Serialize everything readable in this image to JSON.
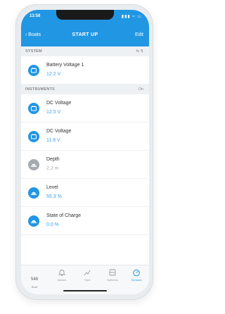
{
  "status_bar": {
    "time": "13:58",
    "icons": "▮▮▮ ≈ ▭"
  },
  "nav": {
    "back_label": "‹ Boats",
    "title": "START UP",
    "edit_label": "Edit"
  },
  "sections": {
    "system": {
      "label": "SYSTEM",
      "extra": "⇆ ⇅"
    },
    "instruments": {
      "label": "INSTRUMENTS",
      "extra": "On"
    }
  },
  "rows": [
    {
      "title": "Battery Voltage 1",
      "value": "12.2 V",
      "icon": "battery-icon",
      "muted": false
    },
    {
      "title": "DC Voltage",
      "value": "12.5 V",
      "icon": "battery-icon",
      "muted": false
    },
    {
      "title": "DC Voltage",
      "value": "11.8 V",
      "icon": "battery-icon",
      "muted": false
    },
    {
      "title": "Depth",
      "value": "2.2 m",
      "icon": "depth-icon",
      "muted": true
    },
    {
      "title": "Level",
      "value": "55.3 %",
      "icon": "tank-level-icon",
      "muted": false
    },
    {
      "title": "State of Charge",
      "value": "0.0 %",
      "icon": "tank-level-icon",
      "muted": false
    }
  ],
  "tabs": {
    "boat": {
      "number": "548",
      "label": "Boat"
    },
    "items": [
      {
        "label": "Alarms",
        "icon": "bell-icon",
        "active": false
      },
      {
        "label": "Trips",
        "icon": "trips-icon",
        "active": false
      },
      {
        "label": "Switches",
        "icon": "switches-icon",
        "active": false
      },
      {
        "label": "Sensors",
        "icon": "gauge-icon",
        "active": true
      }
    ]
  },
  "colors": {
    "accent": "#2196e3",
    "muted_icon": "#a6abb0",
    "value_text": "#3ba1ea"
  }
}
